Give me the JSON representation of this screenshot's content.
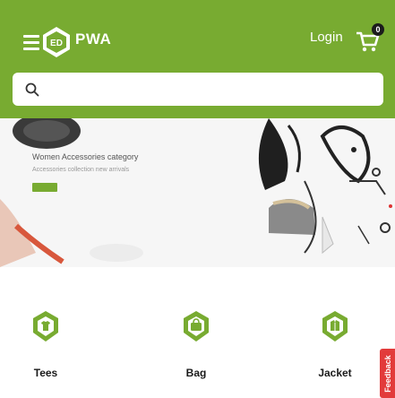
{
  "header": {
    "brand": "PWA",
    "logo_text": "ED",
    "login_label": "Login",
    "cart_count": "0",
    "background": "#78ab31"
  },
  "search": {
    "placeholder": "",
    "icon": "search-icon"
  },
  "hero": {
    "headline": "Women Accessories category",
    "subline": "Accessories collection new arrivals",
    "button_color": "#78ab31"
  },
  "categories": [
    {
      "label": "Tees",
      "icon": "tee-icon"
    },
    {
      "label": "Bag",
      "icon": "bag-icon"
    },
    {
      "label": "Jacket",
      "icon": "jacket-icon"
    }
  ],
  "feedback": {
    "label": "Feedback",
    "color": "#e23b3b"
  }
}
